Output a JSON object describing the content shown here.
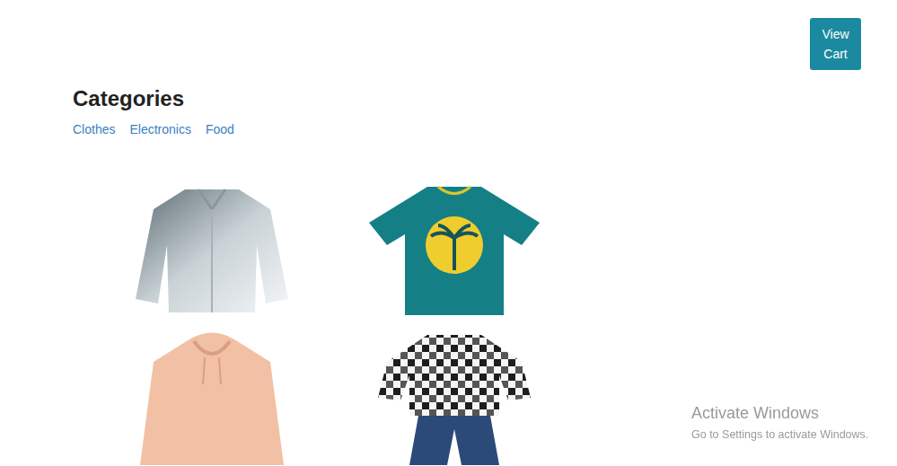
{
  "header": {
    "cart_button": "View Cart"
  },
  "categories": {
    "title": "Categories",
    "links": [
      "Clothes",
      "Electronics",
      "Food"
    ]
  },
  "products": [
    {
      "kind": "shirt"
    },
    {
      "kind": "tshirt"
    },
    {
      "kind": "hoodie"
    },
    {
      "kind": "outfit"
    }
  ],
  "watermark": {
    "title": "Activate Windows",
    "subtitle": "Go to Settings to activate Windows."
  }
}
